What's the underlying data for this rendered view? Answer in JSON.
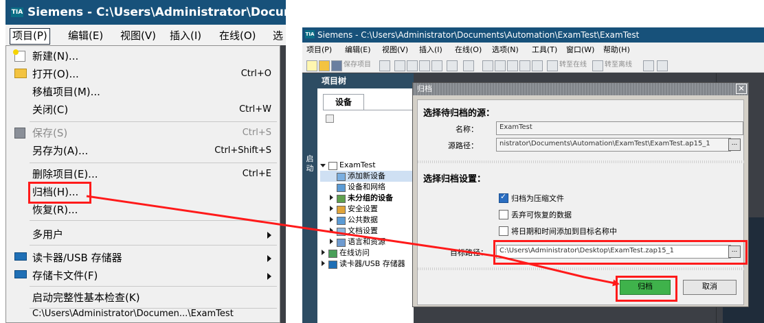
{
  "left": {
    "title": "Siemens  -  C:\\Users\\Administrator\\Document",
    "menubar": [
      "项目(P)",
      "编辑(E)",
      "视图(V)",
      "插入(I)",
      "在线(O)",
      "选"
    ],
    "menu_items": [
      {
        "label": "新建(N)...",
        "shortcut": "",
        "icon": "new-project-icon"
      },
      {
        "label": "打开(O)...",
        "shortcut": "Ctrl+O",
        "icon": "open-folder-icon"
      },
      {
        "label": "移植项目(M)...",
        "shortcut": ""
      },
      {
        "label": "关闭(C)",
        "shortcut": "Ctrl+W"
      },
      {
        "label": "保存(S)",
        "shortcut": "Ctrl+S",
        "icon": "save-icon",
        "disabled": true
      },
      {
        "label": "另存为(A)...",
        "shortcut": "Ctrl+Shift+S"
      },
      {
        "label": "删除项目(E)...",
        "shortcut": "Ctrl+E"
      },
      {
        "label": "归档(H)...",
        "shortcut": ""
      },
      {
        "label": "恢复(R)...",
        "shortcut": ""
      },
      {
        "label": "多用户",
        "shortcut": ""
      },
      {
        "label": "读卡器/USB 存储器",
        "shortcut": "",
        "icon": "card-reader-icon"
      },
      {
        "label": "存储卡文件(F)",
        "shortcut": "",
        "icon": "memory-card-icon"
      },
      {
        "label": "启动完整性基本检查(K)",
        "shortcut": ""
      },
      {
        "label": "C:\\Users\\Administrator\\Documen...\\ExamTest",
        "shortcut": ""
      }
    ]
  },
  "right": {
    "title": "Siemens  -  C:\\Users\\Administrator\\Documents\\Automation\\ExamTest\\ExamTest",
    "menubar": [
      "项目(P)",
      "编辑(E)",
      "视图(V)",
      "插入(I)",
      "在线(O)",
      "选项(N)",
      "工具(T)",
      "窗口(W)",
      "帮助(H)"
    ],
    "toolbar": {
      "save_project": "保存项目",
      "go_online": "转至在线",
      "go_offline": "转至离线"
    },
    "project_tree": {
      "header": "项目树",
      "side_label": "启动",
      "tab_devices": "设备",
      "items": [
        {
          "label": "ExamTest",
          "level": 0
        },
        {
          "label": "添加新设备",
          "level": 1
        },
        {
          "label": "设备和网络",
          "level": 1
        },
        {
          "label": "未分组的设备",
          "level": 1
        },
        {
          "label": "安全设置",
          "level": 1
        },
        {
          "label": "公共数据",
          "level": 1
        },
        {
          "label": "文档设置",
          "level": 1
        },
        {
          "label": "语言和资源",
          "level": 1
        },
        {
          "label": "在线访问",
          "level": 0
        },
        {
          "label": "读卡器/USB 存储器",
          "level": 0
        }
      ]
    },
    "dialog": {
      "title": "归档",
      "source_heading": "选择待归档的源：",
      "name_label": "名称：",
      "name_value": "ExamTest",
      "source_path_label": "源路径：",
      "source_path_value": "nistrator\\Documents\\Automation\\ExamTest\\ExamTest.ap15_1",
      "settings_heading": "选择归档设置：",
      "opt_compress": "归档为压缩文件",
      "opt_discard": "丢弃可恢复的数据",
      "opt_datetime": "将日期和时间添加到目标名称中",
      "target_label": "目标路径：",
      "target_value": "C:\\Users\\Administrator\\Desktop\\ExamTest.zap15_1",
      "browse": "...",
      "ok": "归档",
      "cancel": "取消"
    }
  },
  "colors": {
    "highlight_red": "#ff1a1a",
    "titlebar": "#17517a",
    "ok_green": "#3fb24b"
  }
}
